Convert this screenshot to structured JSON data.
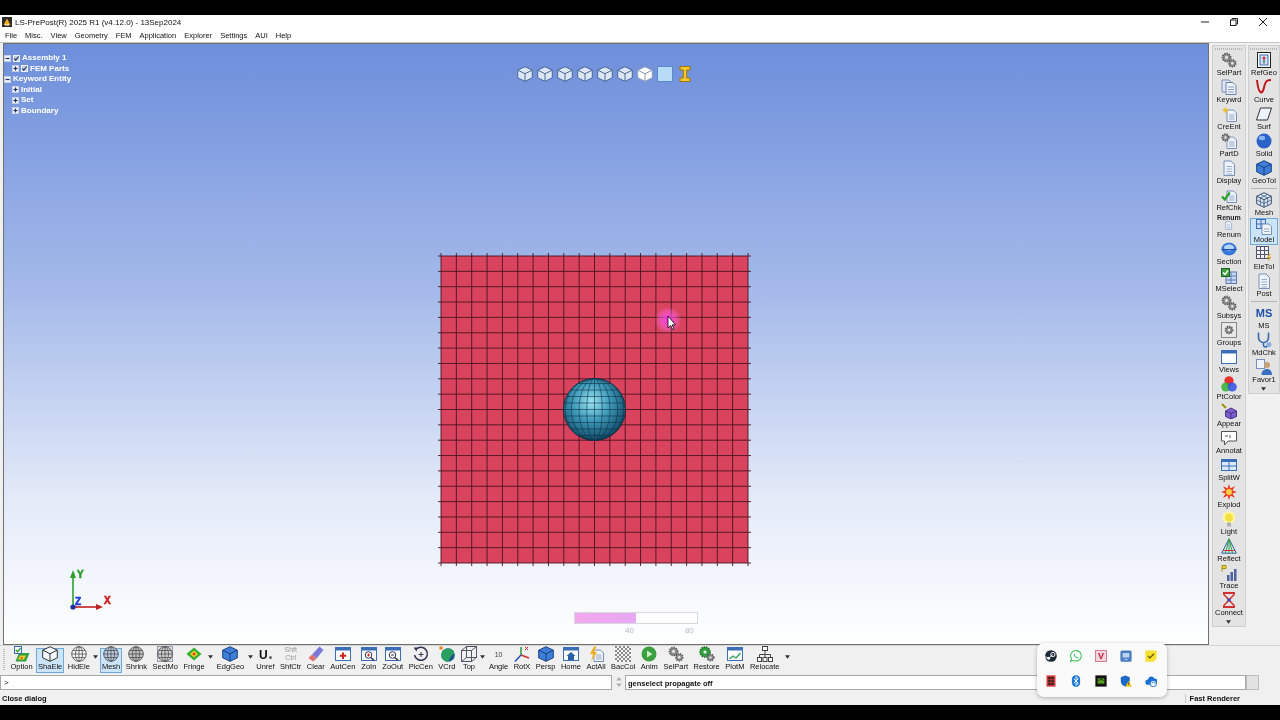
{
  "window": {
    "title": "LS-PrePost(R) 2025 R1 (v4.12.0) - 13Sep2024"
  },
  "menu": [
    "File",
    "Misc.",
    "View",
    "Geometry",
    "FEM",
    "Application",
    "Explorer",
    "Settings",
    "AUI",
    "Help"
  ],
  "tree": [
    {
      "label": "Assembly 1",
      "expanded": true,
      "checked": true,
      "children": [
        {
          "label": "FEM Parts",
          "expanded": false,
          "checked": true
        }
      ]
    },
    {
      "label": "Keyword Entity",
      "expanded": true,
      "children": [
        {
          "label": "Initial",
          "expanded": false
        },
        {
          "label": "Set",
          "expanded": false
        },
        {
          "label": "Boundary",
          "expanded": false
        }
      ]
    }
  ],
  "scale_bar": {
    "level": 0.5,
    "labels": [
      "40",
      "80"
    ]
  },
  "axis_triad": {
    "labels": [
      {
        "text": "Y",
        "color": "#2aa02a"
      },
      {
        "text": "Z",
        "color": "#2040d0"
      },
      {
        "text": "X",
        "color": "#d02020"
      }
    ]
  },
  "right_toolbar": {
    "columns": [
      {
        "groups": [
          [
            {
              "label": "SelPart",
              "selected": false
            },
            {
              "label": "Keywrd",
              "selected": false
            },
            {
              "label": "CreEnt",
              "selected": false
            },
            {
              "label": "PartD",
              "selected": false
            },
            {
              "label": "Display",
              "selected": false
            },
            {
              "label": "RefChk",
              "selected": false
            },
            {
              "label": "Renum",
              "selected": false,
              "icon_text": "Renum"
            },
            {
              "label": "Section",
              "selected": false
            },
            {
              "label": "MSelect",
              "selected": false
            },
            {
              "label": "Subsys",
              "selected": false
            },
            {
              "label": "Groups",
              "selected": false
            },
            {
              "label": "Views",
              "selected": false
            },
            {
              "label": "PtColor",
              "selected": false
            },
            {
              "label": "Appear",
              "selected": false
            },
            {
              "label": "Annotat",
              "selected": false
            },
            {
              "label": "SplitW",
              "selected": false
            },
            {
              "label": "Explod",
              "selected": false
            },
            {
              "label": "Light",
              "selected": false
            },
            {
              "label": "Reflect",
              "selected": false
            },
            {
              "label": "Trace",
              "selected": false
            },
            {
              "label": "Connect",
              "selected": false
            }
          ]
        ]
      },
      {
        "groups": [
          [
            {
              "label": "RefGeo",
              "selected": false
            },
            {
              "label": "Curve",
              "selected": false
            },
            {
              "label": "Surf",
              "selected": false
            },
            {
              "label": "Solid",
              "selected": false
            },
            {
              "label": "GeoTol",
              "selected": false
            }
          ],
          [
            {
              "label": "Mesh",
              "selected": false
            },
            {
              "label": "Model",
              "selected": true
            },
            {
              "label": "EleTol",
              "selected": false
            },
            {
              "label": "Post",
              "selected": false
            }
          ],
          [
            {
              "label": "MS",
              "selected": false,
              "icon_text": "MS"
            },
            {
              "label": "MdChk",
              "selected": false
            },
            {
              "label": "Favor1",
              "selected": false
            }
          ]
        ]
      }
    ]
  },
  "bottom_toolbar": [
    {
      "label": "Option",
      "selected": false,
      "has_menu": false
    },
    {
      "label": "ShaEle",
      "selected": true,
      "has_menu": false
    },
    {
      "label": "HidEle",
      "selected": false,
      "has_menu": true
    },
    {
      "label": "Mesh",
      "selected": true,
      "has_menu": false
    },
    {
      "label": "Shrink",
      "selected": false,
      "has_menu": false
    },
    {
      "label": "SectMo",
      "selected": false,
      "has_menu": false
    },
    {
      "label": "Fringe",
      "selected": false,
      "has_menu": true
    },
    {
      "label": "EdgGeo",
      "selected": false,
      "has_menu": true
    },
    {
      "label": "Unref",
      "selected": false,
      "has_menu": false,
      "icon_text": "U"
    },
    {
      "label": "ShfCtr",
      "selected": false,
      "has_menu": false,
      "icon_lines": [
        "Shft",
        "Ctrl"
      ]
    },
    {
      "label": "Clear",
      "selected": false,
      "has_menu": false
    },
    {
      "label": "AutCen",
      "selected": false,
      "has_menu": false
    },
    {
      "label": "ZoIn",
      "selected": false,
      "has_menu": false
    },
    {
      "label": "ZoOut",
      "selected": false,
      "has_menu": false
    },
    {
      "label": "PicCen",
      "selected": false,
      "has_menu": false
    },
    {
      "label": "VCrd",
      "selected": false,
      "has_menu": false
    },
    {
      "label": "Top",
      "selected": false,
      "has_menu": true
    },
    {
      "label": "Angle",
      "selected": false,
      "has_menu": false,
      "icon_text": "10"
    },
    {
      "label": "RotX",
      "selected": false,
      "has_menu": false
    },
    {
      "label": "Persp",
      "selected": false,
      "has_menu": false
    },
    {
      "label": "Home",
      "selected": false,
      "has_menu": false
    },
    {
      "label": "ActAll",
      "selected": false,
      "has_menu": false
    },
    {
      "label": "BacCol",
      "selected": false,
      "has_menu": false
    },
    {
      "label": "Anim",
      "selected": false,
      "has_menu": false
    },
    {
      "label": "SelPart",
      "selected": false,
      "has_menu": false
    },
    {
      "label": "Restore",
      "selected": false,
      "has_menu": false
    },
    {
      "label": "PlotM",
      "selected": false,
      "has_menu": false
    },
    {
      "label": "Relocate",
      "selected": false,
      "has_menu": false
    }
  ],
  "command": {
    "prompt": ">",
    "messages": [
      "genselect propagate off"
    ]
  },
  "status_bar": {
    "message": "Close dialog",
    "renderer": "Fast Renderer"
  },
  "tray_popup": {
    "tile_letter": "V"
  }
}
